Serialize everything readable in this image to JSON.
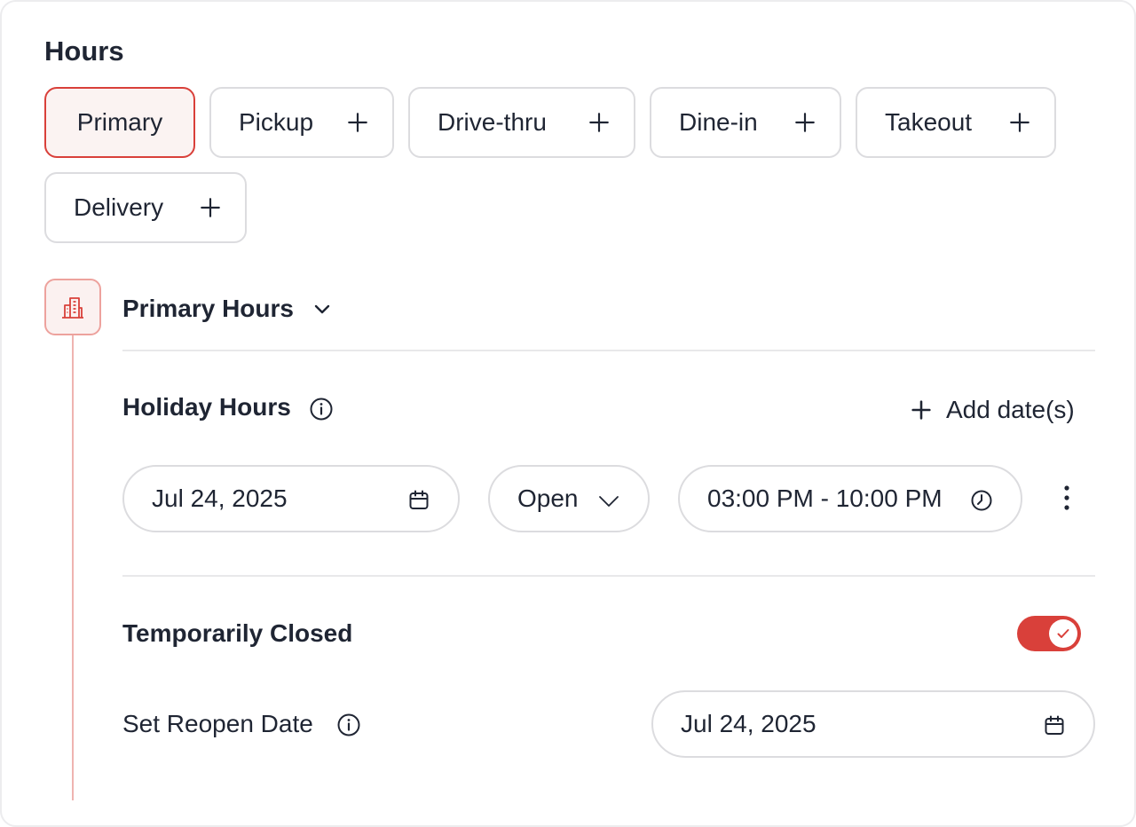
{
  "card": {
    "title": "Hours"
  },
  "hour_types": [
    {
      "label": "Primary",
      "active": true
    },
    {
      "label": "Pickup",
      "active": false
    },
    {
      "label": "Drive-thru",
      "active": false
    },
    {
      "label": "Dine-in",
      "active": false
    },
    {
      "label": "Takeout",
      "active": false
    },
    {
      "label": "Delivery",
      "active": false
    }
  ],
  "primary_section": {
    "title": "Primary Hours",
    "icon": "building-icon"
  },
  "holiday": {
    "title": "Holiday Hours",
    "add_label": "Add date(s)",
    "entry": {
      "date": "Jul 24, 2025",
      "status": "Open",
      "time_range": "03:00 PM - 10:00 PM"
    }
  },
  "temporarily_closed": {
    "title": "Temporarily Closed",
    "enabled": true,
    "reopen_label": "Set Reopen Date",
    "reopen_date": "Jul 24, 2025"
  },
  "colors": {
    "accent": "#d9403a",
    "accent_light": "#fbf3f2",
    "border": "#dcdcdf",
    "text": "#1f2533"
  }
}
